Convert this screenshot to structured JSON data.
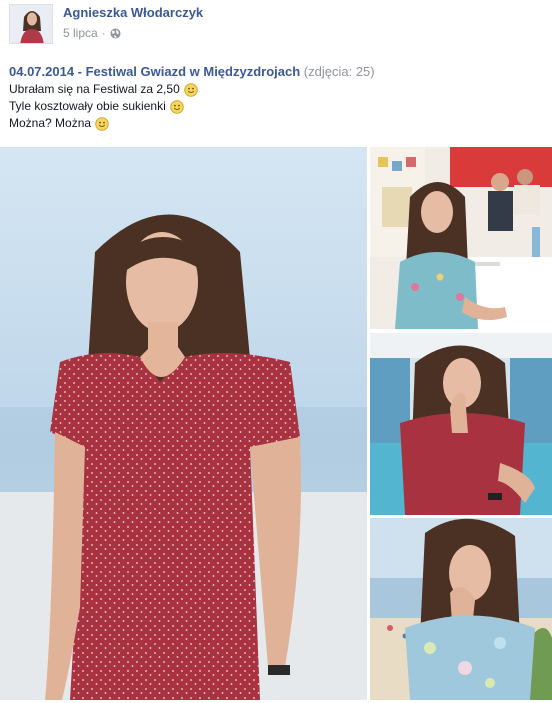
{
  "post": {
    "author": "Agnieszka Włodarczyk",
    "date": "5 lipca",
    "privacy_icon": "globe-icon",
    "album_title": "04.07.2014 - Festiwal Gwiazd w Międzyzdrojach",
    "photo_count": "(zdjęcia: 25)",
    "lines": [
      {
        "text": "Ubrałam się na Festiwal za 2,50",
        "emoji": "smile-icon"
      },
      {
        "text": "Tyle kosztowały obie sukienki",
        "emoji": "smile-icon"
      },
      {
        "text": "Można? Można",
        "emoji": "smile-icon"
      }
    ]
  },
  "colors": {
    "link": "#3b5998",
    "muted": "#90949c",
    "text": "#141823",
    "dress_red": "#a8323f",
    "dress_blue": "#7fbcc9"
  }
}
